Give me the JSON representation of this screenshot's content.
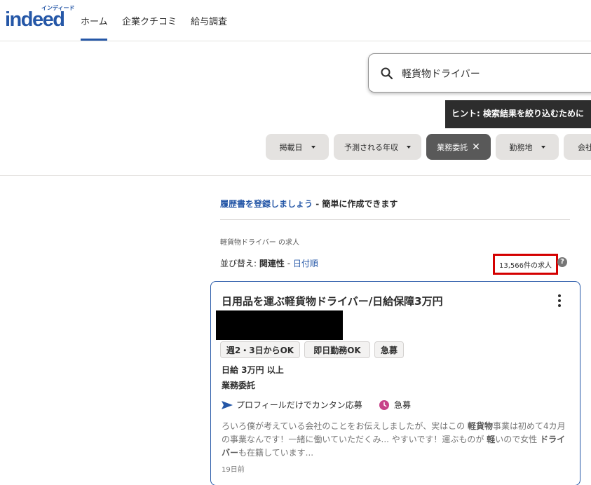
{
  "brand": {
    "logo_kana": "インディード",
    "logo_text": "indeed",
    "brand_color": "#2557a7"
  },
  "nav": {
    "home": "ホーム",
    "company_reviews": "企業クチコミ",
    "salary_search": "給与調査"
  },
  "search": {
    "value": "軽貨物ドライバー",
    "icon": "search-icon"
  },
  "hint": {
    "text": "ヒント: 検索結果を絞り込むために"
  },
  "filters": [
    {
      "label": "掲載日",
      "active": false
    },
    {
      "label": "予測される年収",
      "active": false
    },
    {
      "label": "業務委託",
      "active": true
    },
    {
      "label": "勤務地",
      "active": false
    },
    {
      "label": "会社",
      "active": false
    }
  ],
  "resume": {
    "link": "履歴書を登録しましょう",
    "rest": " - 簡単に作成できます"
  },
  "results": {
    "heading": "軽貨物ドライバー の求人",
    "sort_label": "並び替え: ",
    "sort_active": "関連性",
    "sort_sep": " - ",
    "sort_date": "日付順",
    "count": "13,566件の求人",
    "highlight_color": "#d40000"
  },
  "job": {
    "title": "日用品を運ぶ軽貨物ドライバー/日給保障3万円",
    "tags": [
      "週2・3日からOK",
      "即日勤務OK",
      "急募"
    ],
    "salary": "日給 3万円 以上",
    "job_type": "業務委託",
    "easy_apply": "プロフィールだけでカンタン応募",
    "urgent": "急募",
    "snippet_parts": [
      "ろいろ僕が考えている会社のことをお伝えしましたが、実はこの ",
      "軽貨物",
      "事業は初めて4カ月の事業なんです！一緒に働いていただくみ... やすいです！運ぶものが ",
      "軽",
      "いので女性 ",
      "ドライバー",
      "も在籍しています..."
    ],
    "posted": "19日前",
    "urgent_color": "#c74289"
  }
}
